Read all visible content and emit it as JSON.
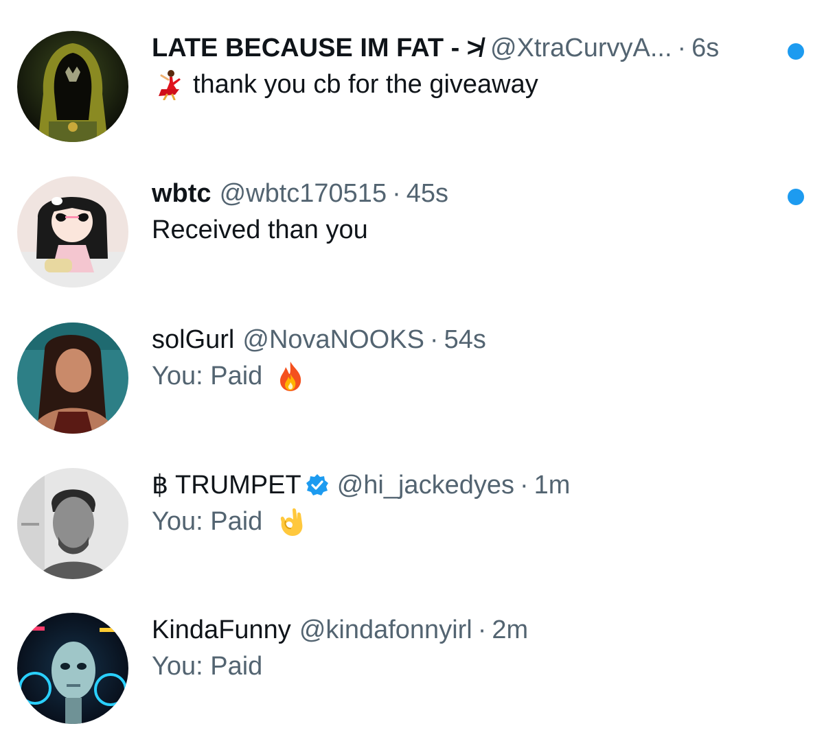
{
  "colors": {
    "text_primary": "#0f1419",
    "text_secondary": "#536471",
    "unread_dot": "#1d9bf0",
    "verified_badge": "#1d9bf0"
  },
  "conversations": [
    {
      "name": "LATE BECAUSE IM FAT - ≯",
      "handle": "@XtraCurvyA...",
      "separator": "·",
      "time": "6s",
      "preview": "thank you cb for the giveaway",
      "preview_prefix_icon": "dancer-emoji",
      "unread": true,
      "verified": false,
      "avatar_icon": "hooded-figure-avatar"
    },
    {
      "name": "wbtc",
      "handle": "@wbtc170515",
      "separator": "·",
      "time": "45s",
      "preview": "Received than you",
      "unread": true,
      "verified": false,
      "avatar_icon": "cartoon-girl-avatar"
    },
    {
      "name": "solGurl",
      "handle": "@NovaNOOKS",
      "separator": "·",
      "time": "54s",
      "preview": "You: Paid",
      "preview_suffix_icon": "fire-emoji",
      "unread": false,
      "verified": false,
      "avatar_icon": "photo-avatar"
    },
    {
      "name": "฿ TRUMPET",
      "handle": "@hi_jackedyes",
      "separator": "·",
      "time": "1m",
      "preview": "You: Paid",
      "preview_suffix_icon": "ok-hand-emoji",
      "unread": false,
      "verified": true,
      "avatar_icon": "photo-avatar"
    },
    {
      "name": "KindaFunny",
      "handle": "@kindafonnyirl",
      "separator": "·",
      "time": "2m",
      "preview": "You: Paid",
      "unread": false,
      "verified": false,
      "avatar_icon": "robot-avatar"
    }
  ]
}
